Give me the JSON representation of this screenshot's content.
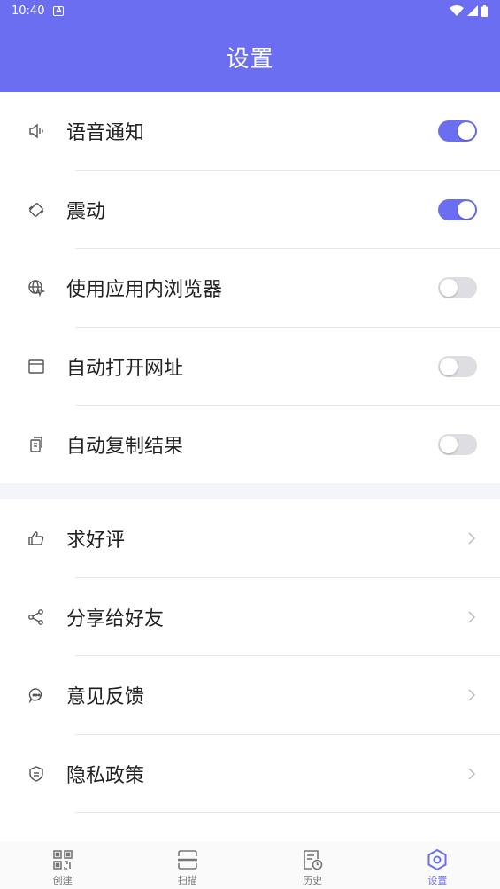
{
  "status_bar": {
    "time": "10:40",
    "badge": "A"
  },
  "header": {
    "title": "设置"
  },
  "toggle_section": [
    {
      "label": "语音通知",
      "icon": "speaker-icon",
      "on": true
    },
    {
      "label": "震动",
      "icon": "vibrate-icon",
      "on": true
    },
    {
      "label": "使用应用内浏览器",
      "icon": "globe-cursor-icon",
      "on": false
    },
    {
      "label": "自动打开网址",
      "icon": "browser-window-icon",
      "on": false
    },
    {
      "label": "自动复制结果",
      "icon": "copy-icon",
      "on": false
    }
  ],
  "link_section": [
    {
      "label": "求好评",
      "icon": "thumbs-up-icon"
    },
    {
      "label": "分享给好友",
      "icon": "share-icon"
    },
    {
      "label": "意见反馈",
      "icon": "feedback-chat-icon"
    },
    {
      "label": "隐私政策",
      "icon": "shield-icon"
    }
  ],
  "tab_bar": [
    {
      "label": "创建",
      "icon": "qr-code-icon",
      "active": false
    },
    {
      "label": "扫描",
      "icon": "scan-icon",
      "active": false
    },
    {
      "label": "历史",
      "icon": "history-icon",
      "active": false
    },
    {
      "label": "设置",
      "icon": "settings-gear-icon",
      "active": true
    }
  ],
  "colors": {
    "accent": "#6b6ef0",
    "icon_gray": "#555555",
    "text": "#222222"
  }
}
